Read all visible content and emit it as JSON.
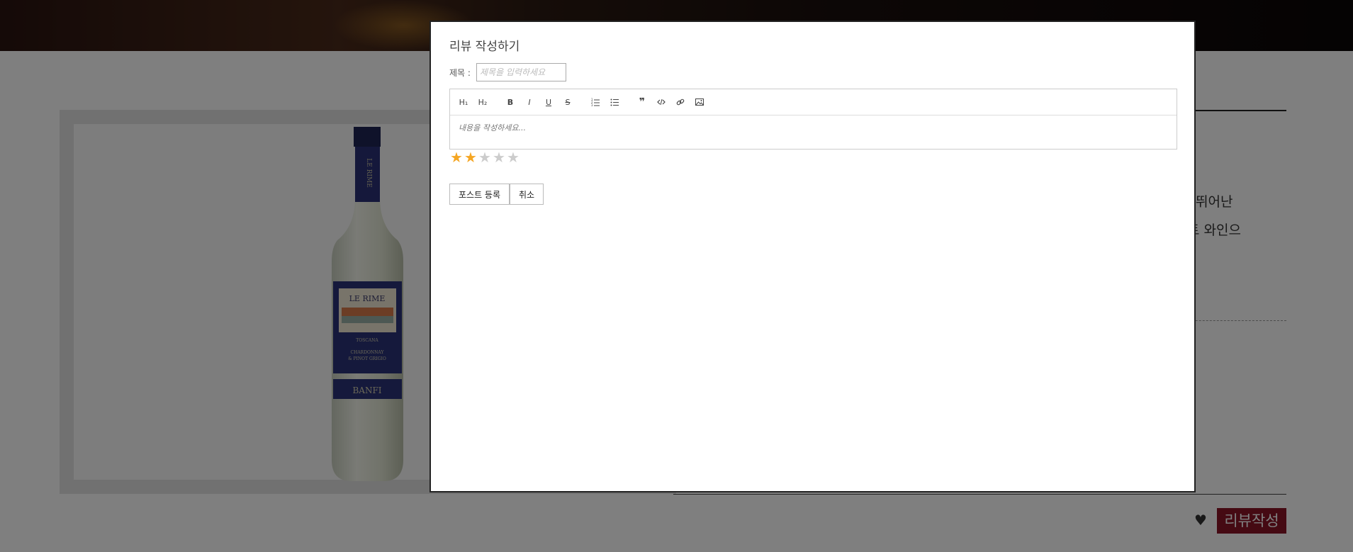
{
  "background": {
    "detail_text_1": "있다. 뛰어난",
    "detail_text_2": "화이트 와인으",
    "review_button": "리뷰작성",
    "heart_icon": "heart-icon",
    "bottle": {
      "label_title": "LE RIME",
      "label_region": "TOSCANA",
      "label_grapes_1": "CHARDONNAY",
      "label_grapes_2": "& PINOT GRIGIO",
      "label_brand": "BANFI"
    }
  },
  "modal": {
    "title": "리뷰 작성하기",
    "title_label": "제목 :",
    "title_placeholder": "제목을 입력하세요",
    "title_value": "",
    "editor_placeholder": "내용을 작성하세요...",
    "toolbar": [
      {
        "name": "h1-button",
        "label": "H₁"
      },
      {
        "name": "h2-button",
        "label": "H₂"
      },
      {
        "name": "bold-button",
        "label": "B"
      },
      {
        "name": "italic-button",
        "label": "I"
      },
      {
        "name": "underline-button",
        "label": "U"
      },
      {
        "name": "strike-button",
        "label": "S"
      },
      {
        "name": "ordered-list-button",
        "icon": "ordered-list-icon"
      },
      {
        "name": "bullet-list-button",
        "icon": "bullet-list-icon"
      },
      {
        "name": "blockquote-button",
        "icon": "quote-icon"
      },
      {
        "name": "code-button",
        "icon": "code-icon"
      },
      {
        "name": "link-button",
        "icon": "link-icon"
      },
      {
        "name": "image-button",
        "icon": "image-icon"
      }
    ],
    "rating": {
      "value": 2,
      "max": 5,
      "filled_color": "#f5a623",
      "empty_color": "#cccccc"
    },
    "submit_label": "포스트 등록",
    "cancel_label": "취소"
  },
  "colors": {
    "accent": "#8a1426",
    "overlay": "rgba(0,0,0,0.5)"
  }
}
